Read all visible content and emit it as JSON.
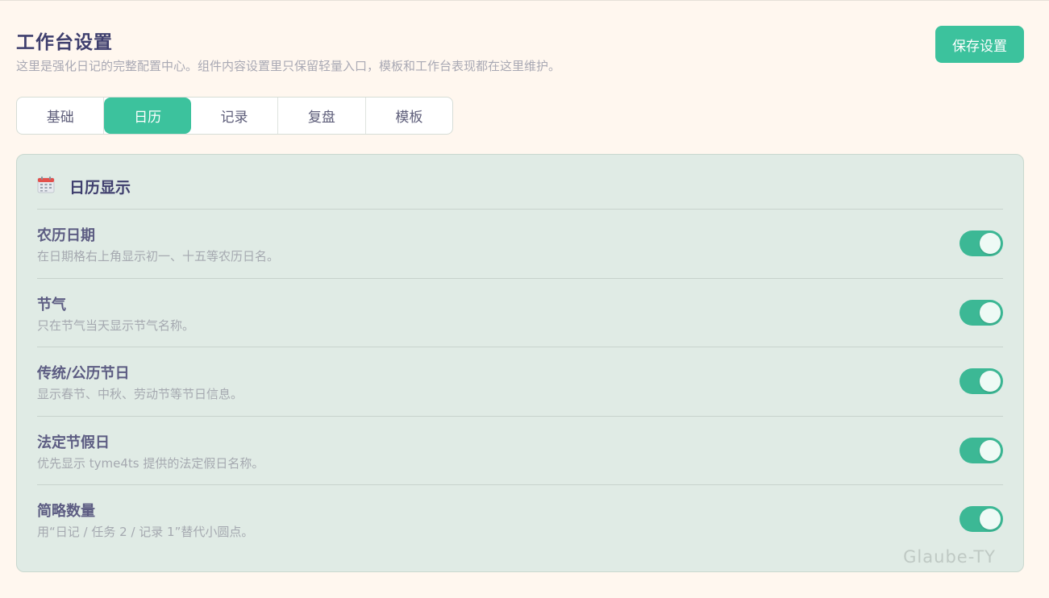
{
  "header": {
    "title": "工作台设置",
    "subtitle": "这里是强化日记的完整配置中心。组件内容设置里只保留轻量入口，模板和工作台表现都在这里维护。",
    "save_label": "保存设置"
  },
  "tabs": [
    {
      "label": "基础",
      "active": false
    },
    {
      "label": "日历",
      "active": true
    },
    {
      "label": "记录",
      "active": false
    },
    {
      "label": "复盘",
      "active": false
    },
    {
      "label": "模板",
      "active": false
    }
  ],
  "section": {
    "icon": "calendar-icon",
    "title": "日历显示",
    "rows": [
      {
        "label": "农历日期",
        "desc": "在日期格右上角显示初一、十五等农历日名。",
        "enabled": true
      },
      {
        "label": "节气",
        "desc": "只在节气当天显示节气名称。",
        "enabled": true
      },
      {
        "label": "传统/公历节日",
        "desc": "显示春节、中秋、劳动节等节日信息。",
        "enabled": true
      },
      {
        "label": "法定节假日",
        "desc": "优先显示 tyme4ts 提供的法定假日名称。",
        "enabled": true
      },
      {
        "label": "简略数量",
        "desc": "用“日记 / 任务 2 / 记录 1”替代小圆点。",
        "enabled": true
      }
    ]
  },
  "watermark": "Glaube-TY",
  "colors": {
    "accent": "#3cc29d",
    "background": "#fff7ef",
    "card": "#e0ebe5"
  }
}
